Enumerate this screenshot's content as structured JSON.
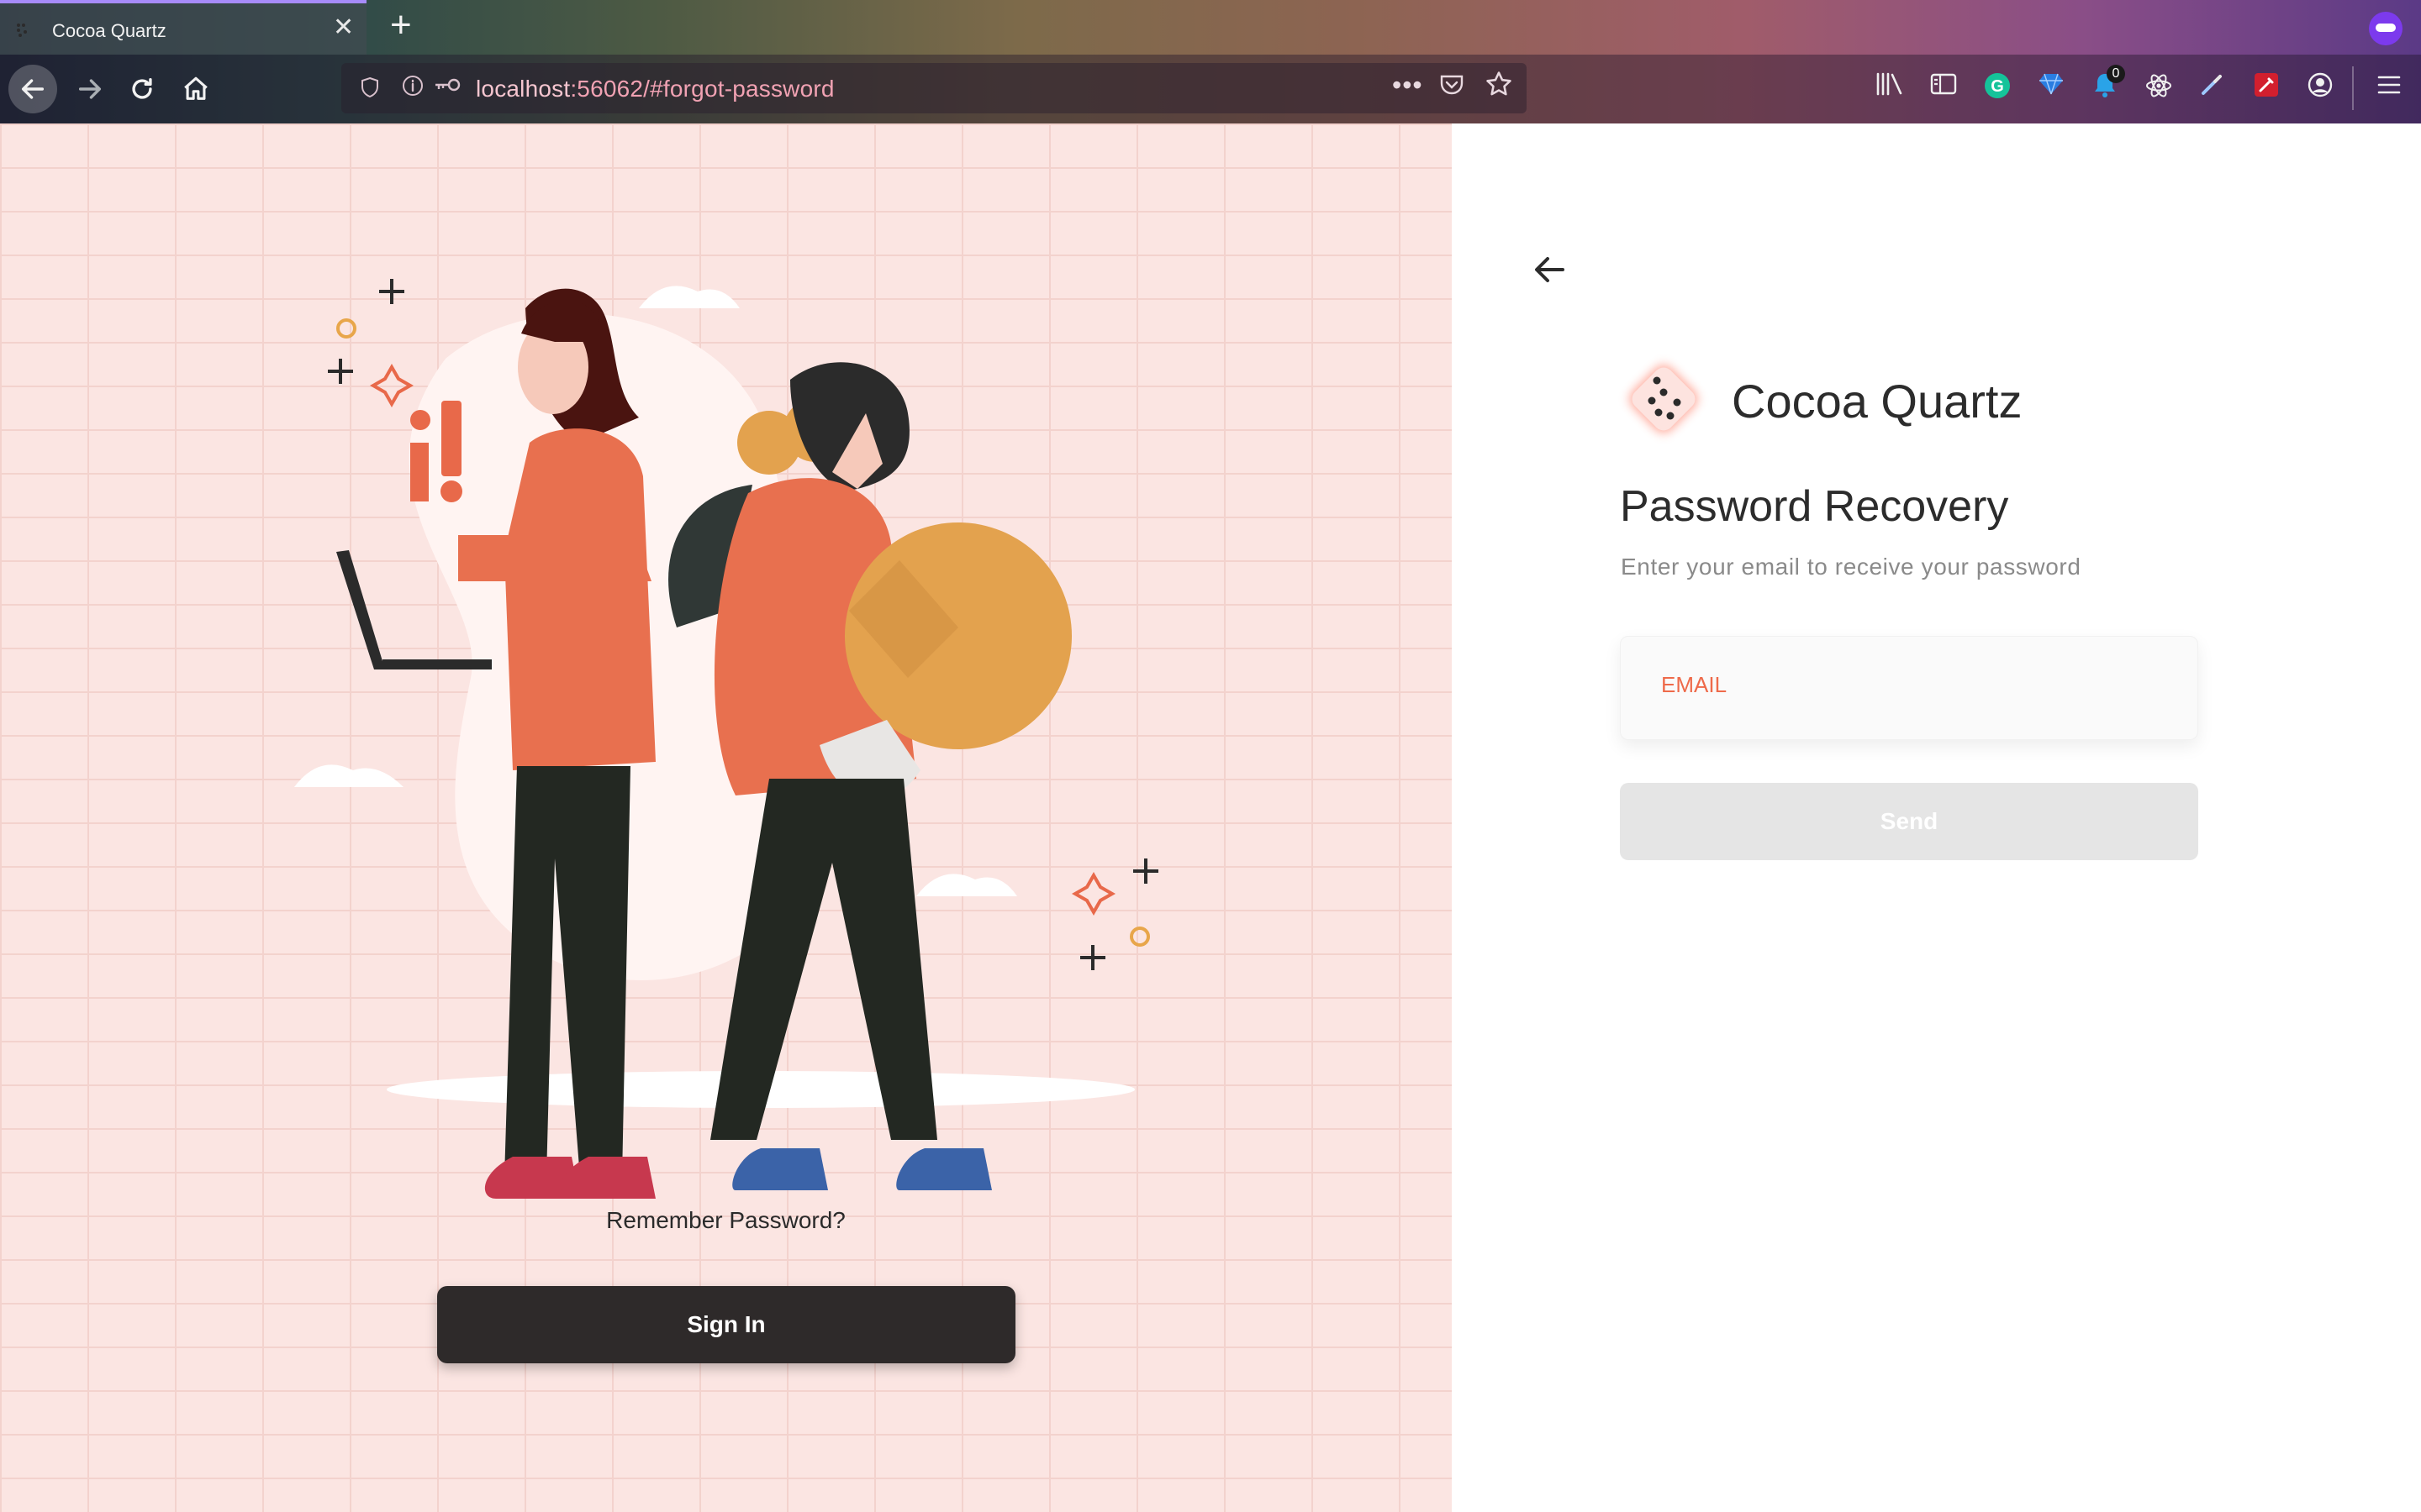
{
  "browser": {
    "tab_title": "Cocoa Quartz",
    "tab_close": "✕",
    "new_tab": "+",
    "url_host": "localhost",
    "url_rest": ":56062/#forgot-password",
    "toolbar_badge": "0"
  },
  "icons": {
    "back": "back-arrow-icon",
    "forward": "forward-arrow-icon",
    "reload": "reload-icon",
    "home": "home-icon",
    "library": "library-icon",
    "sidebar": "sidebar-icon",
    "grammarly": "grammarly-icon",
    "gem": "gem-icon",
    "notifications": "bell-icon",
    "react": "react-devtools-icon",
    "eyedropper": "eyedropper-icon",
    "edit": "edit-icon",
    "account": "account-icon",
    "menu": "hamburger-menu-icon"
  },
  "left": {
    "remember_text": "Remember Password?",
    "signin_label": "Sign In"
  },
  "form": {
    "app_name": "Cocoa Quartz",
    "title": "Password Recovery",
    "subtitle": "Enter your email to receive your password",
    "email_label": "EMAIL",
    "send_label": "Send"
  },
  "colors": {
    "accent": "#ee6a4a",
    "panel_bg": "#fbe5e2",
    "primary_button": "#2e2a2a",
    "disabled_button": "#e5e5e5"
  }
}
